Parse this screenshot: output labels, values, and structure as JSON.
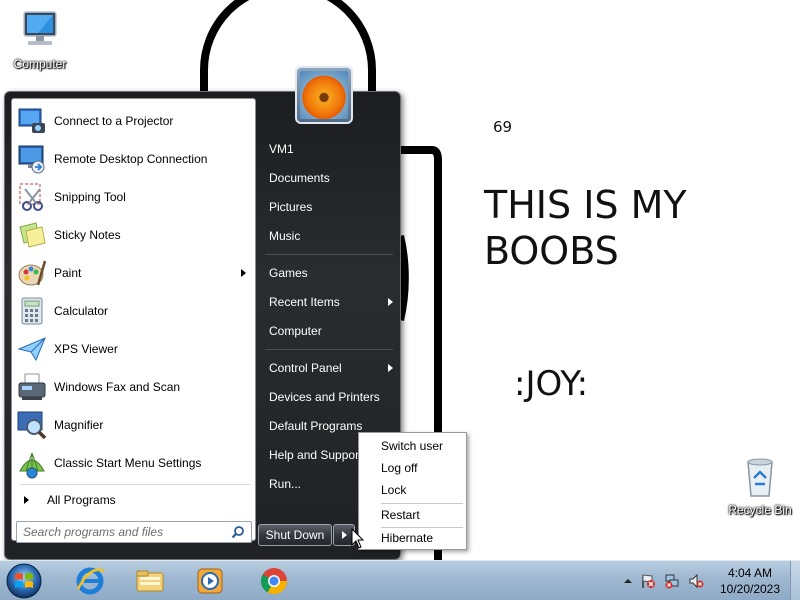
{
  "desktop": {
    "icons": [
      {
        "label": "Computer",
        "icon": "computer-icon"
      },
      {
        "label": "Recycle Bin",
        "icon": "recycle-bin-icon"
      }
    ],
    "wallpaper_text": {
      "number": "69",
      "main": "THIS IS MY BOOBS",
      "joy": ":JOY:"
    }
  },
  "start_menu": {
    "programs": [
      {
        "label": "Connect to a Projector",
        "icon": "projector-icon",
        "submenu": false
      },
      {
        "label": "Remote Desktop Connection",
        "icon": "remote-desktop-icon",
        "submenu": false
      },
      {
        "label": "Snipping Tool",
        "icon": "scissors-icon",
        "submenu": false
      },
      {
        "label": "Sticky Notes",
        "icon": "sticky-notes-icon",
        "submenu": false
      },
      {
        "label": "Paint",
        "icon": "paint-palette-icon",
        "submenu": true
      },
      {
        "label": "Calculator",
        "icon": "calculator-icon",
        "submenu": false
      },
      {
        "label": "XPS Viewer",
        "icon": "paper-plane-icon",
        "submenu": false
      },
      {
        "label": "Windows Fax and Scan",
        "icon": "fax-icon",
        "submenu": false
      },
      {
        "label": "Magnifier",
        "icon": "magnifier-icon",
        "submenu": false
      },
      {
        "label": "Classic Start Menu Settings",
        "icon": "shell-icon",
        "submenu": false
      }
    ],
    "all_programs_label": "All Programs",
    "search_placeholder": "Search programs and files",
    "right_links": [
      {
        "label": "VM1",
        "submenu": false
      },
      {
        "label": "Documents",
        "submenu": false
      },
      {
        "label": "Pictures",
        "submenu": false
      },
      {
        "label": "Music",
        "submenu": false
      },
      {
        "label": "Games",
        "submenu": false
      },
      {
        "label": "Recent Items",
        "submenu": true
      },
      {
        "label": "Computer",
        "submenu": false
      },
      {
        "label": "Control Panel",
        "submenu": true
      },
      {
        "label": "Devices and Printers",
        "submenu": false
      },
      {
        "label": "Default Programs",
        "submenu": false
      },
      {
        "label": "Help and Support",
        "submenu": false
      },
      {
        "label": "Run...",
        "submenu": false
      }
    ],
    "shutdown_label": "Shut Down"
  },
  "shutdown_submenu": {
    "items": [
      "Switch user",
      "Log off",
      "Lock",
      "Restart",
      "Hibernate"
    ]
  },
  "taskbar": {
    "pinned": [
      {
        "name": "internet-explorer-icon"
      },
      {
        "name": "file-explorer-icon"
      },
      {
        "name": "media-player-icon"
      },
      {
        "name": "chrome-icon"
      }
    ],
    "clock_time": "4:04 AM",
    "clock_date": "10/20/2023"
  },
  "colors": {
    "taskbar": "#9fb8d1",
    "start_menu_dark": "#1f2124",
    "wallpaper": "#ffffff"
  }
}
